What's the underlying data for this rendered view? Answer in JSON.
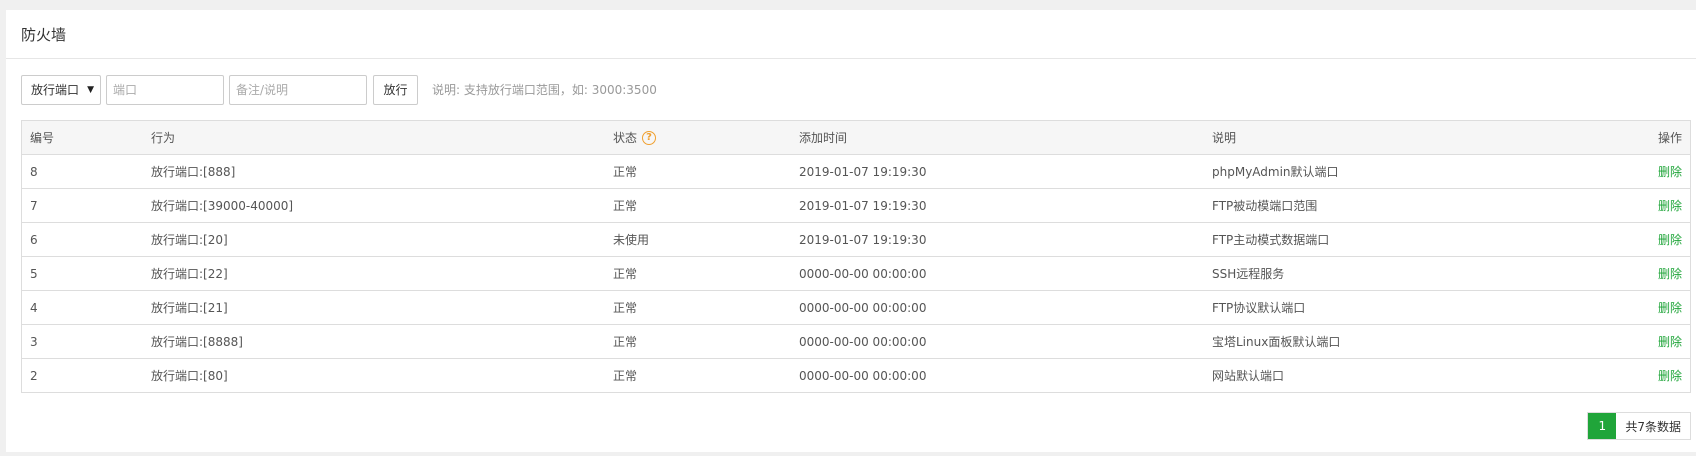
{
  "panel": {
    "title": "防火墙"
  },
  "toolbar": {
    "select_value": "放行端口",
    "port_placeholder": "端口",
    "note_placeholder": "备注/说明",
    "allow_label": "放行",
    "hint": "说明: 支持放行端口范围，如: 3000:3500"
  },
  "table": {
    "headers": {
      "id": "编号",
      "action": "行为",
      "status": "状态",
      "status_help": "?",
      "time": "添加时间",
      "desc": "说明",
      "op": "操作"
    },
    "rows": [
      {
        "id": "8",
        "action": "放行端口:[888]",
        "status": "正常",
        "time": "2019-01-07 19:19:30",
        "desc": "phpMyAdmin默认端口",
        "op": "删除"
      },
      {
        "id": "7",
        "action": "放行端口:[39000-40000]",
        "status": "正常",
        "time": "2019-01-07 19:19:30",
        "desc": "FTP被动模端口范围",
        "op": "删除"
      },
      {
        "id": "6",
        "action": "放行端口:[20]",
        "status": "未使用",
        "time": "2019-01-07 19:19:30",
        "desc": "FTP主动模式数据端口",
        "op": "删除"
      },
      {
        "id": "5",
        "action": "放行端口:[22]",
        "status": "正常",
        "time": "0000-00-00 00:00:00",
        "desc": "SSH远程服务",
        "op": "删除"
      },
      {
        "id": "4",
        "action": "放行端口:[21]",
        "status": "正常",
        "time": "0000-00-00 00:00:00",
        "desc": "FTP协议默认端口",
        "op": "删除"
      },
      {
        "id": "3",
        "action": "放行端口:[8888]",
        "status": "正常",
        "time": "0000-00-00 00:00:00",
        "desc": "宝塔Linux面板默认端口",
        "op": "删除"
      },
      {
        "id": "2",
        "action": "放行端口:[80]",
        "status": "正常",
        "time": "0000-00-00 00:00:00",
        "desc": "网站默认端口",
        "op": "删除"
      }
    ]
  },
  "pager": {
    "current": "1",
    "total": "共7条数据"
  },
  "colors": {
    "accent": "#20a53a",
    "help": "#f0a030"
  }
}
